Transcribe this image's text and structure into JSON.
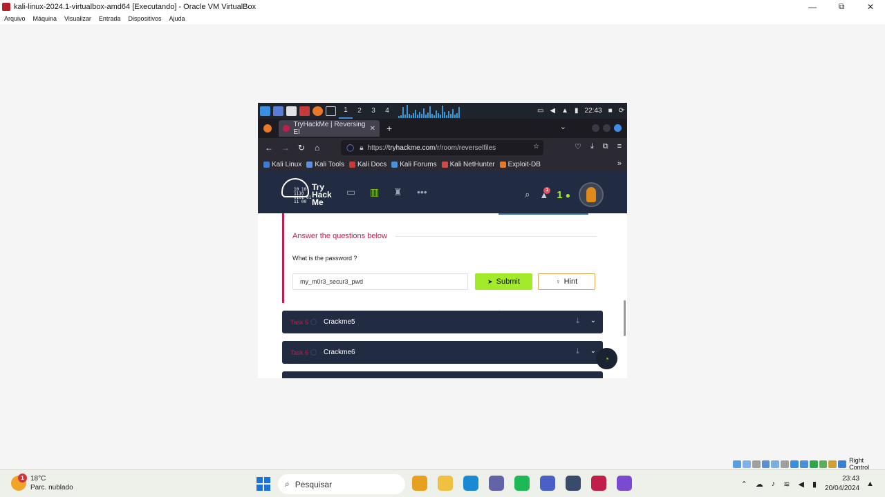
{
  "window": {
    "title": "kali-linux-2024.1-virtualbox-amd64 [Executando] - Oracle VM VirtualBox",
    "controls": [
      "—",
      "⧉",
      "✕"
    ]
  },
  "menubar": [
    "Arquivo",
    "Máquina",
    "Visualizar",
    "Entrada",
    "Dispositivos",
    "Ajuda"
  ],
  "kali_panel": {
    "workspaces": [
      "1",
      "2",
      "3",
      "4"
    ],
    "active_workspace": "1",
    "graph_levels": [
      0.15,
      0.2,
      0.8,
      0.25,
      0.95,
      0.3,
      0.2,
      0.35,
      0.6,
      0.25,
      0.45,
      0.3,
      0.7,
      0.25,
      0.4,
      0.85,
      0.3,
      0.2,
      0.55,
      0.35,
      0.25,
      0.9,
      0.45,
      0.2,
      0.5,
      0.3,
      0.65,
      0.25,
      0.35,
      0.8
    ],
    "clock": "22:43",
    "colors": [
      "#3b8ee0",
      "#5b7cd6",
      "#e0e0e6",
      "#c73a3a",
      "#e8792a",
      "#cfcfd8"
    ]
  },
  "browser": {
    "tab_title": "TryHackMe | Reversing El",
    "tab_close": "✕",
    "new_tab": "+",
    "url_prefix": "https://",
    "url_host": "tryhackme.com",
    "url_path": "/r/room/reverselfiles",
    "bookmarks": [
      {
        "label": "Kali Linux",
        "color": "#3a7bd5"
      },
      {
        "label": "Kali Tools",
        "color": "#5a8ee0"
      },
      {
        "label": "Kali Docs",
        "color": "#c73a3a"
      },
      {
        "label": "Kali Forums",
        "color": "#4a90d9"
      },
      {
        "label": "Kali NetHunter",
        "color": "#d04a4a"
      },
      {
        "label": "Exploit-DB",
        "color": "#e8792a"
      }
    ]
  },
  "thm": {
    "logo_binary": [
      "10  10",
      "1110",
      "0101 01",
      "  11  00"
    ],
    "logo_brand": [
      "Try",
      "Hack",
      "Me"
    ],
    "notification_count": "1",
    "streak": "1"
  },
  "question_panel": {
    "heading": "Answer the questions below",
    "question": "What is the password ?",
    "answer_value": "my_m0r3_secur3_pwd",
    "submit_label": "Submit",
    "hint_label": "Hint"
  },
  "tasks": [
    {
      "label": "Task 5",
      "name": "Crackme5"
    },
    {
      "label": "Task 6",
      "name": "Crackme6"
    }
  ],
  "vbox_status": {
    "host_key": "Right Control",
    "icon_colors": [
      "#5aa0e0",
      "#7fb2e8",
      "#a0a0a0",
      "#5a8fd0",
      "#7ab0e0",
      "#a0a0a0",
      "#3a8ee0",
      "#4a90d9",
      "#2aa84a",
      "#5ab05a",
      "#d0a030",
      "#3a80d0"
    ]
  },
  "taskbar": {
    "weather_temp": "18°C",
    "weather_desc": "Parc. nublado",
    "weather_badge": "1",
    "search_placeholder": "Pesquisar",
    "app_colors": [
      "#e8a020",
      "#f0c040",
      "#1a8ad4",
      "#6264a7",
      "#1db954",
      "#4a60c8",
      "#3a4a6a",
      "#c11e4a",
      "#7a4ad0"
    ],
    "time": "23:43",
    "date": "20/04/2024"
  }
}
